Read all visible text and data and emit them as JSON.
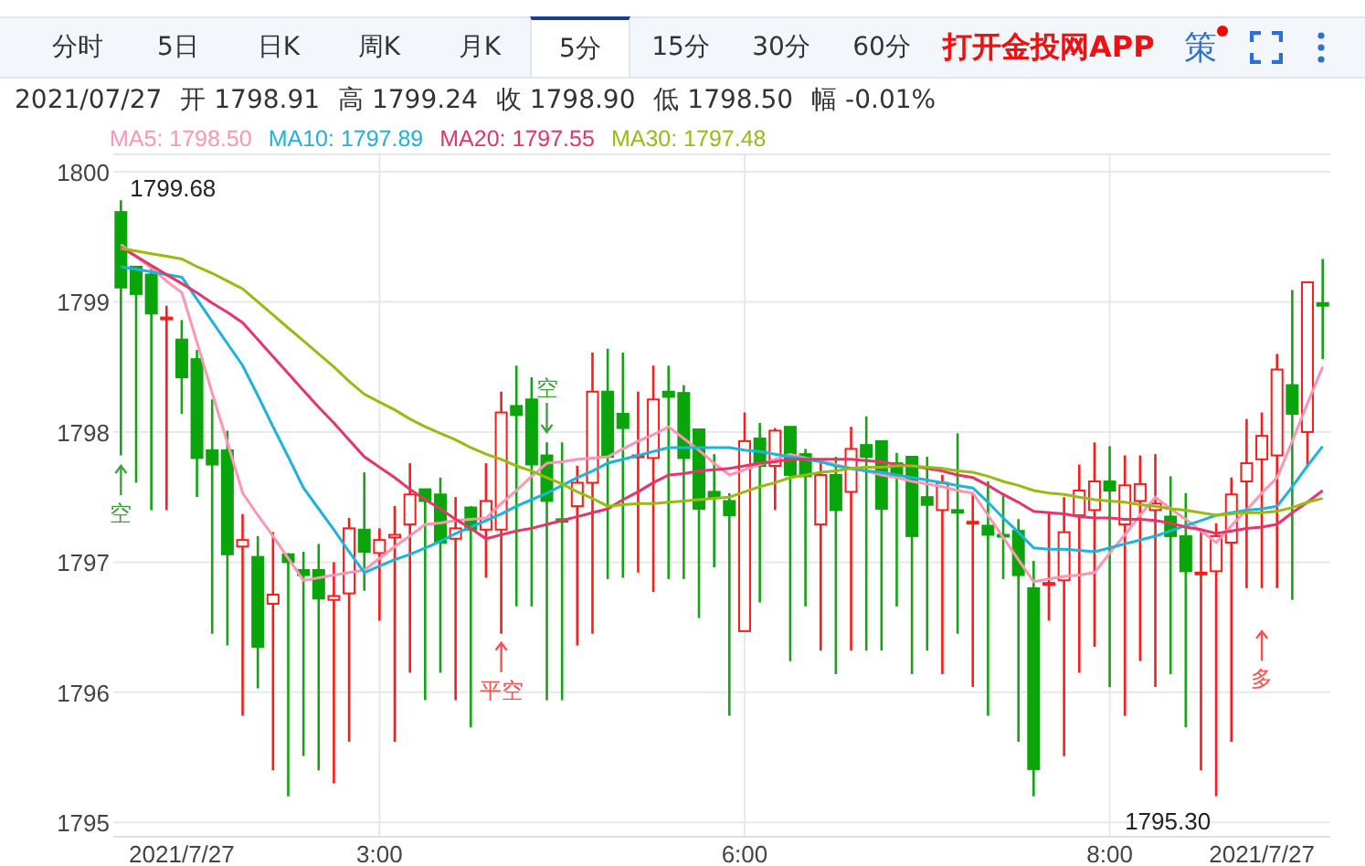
{
  "tabs": [
    {
      "label": "分时",
      "selected": false
    },
    {
      "label": "5日",
      "selected": false
    },
    {
      "label": "日K",
      "selected": false
    },
    {
      "label": "周K",
      "selected": false
    },
    {
      "label": "月K",
      "selected": false
    },
    {
      "label": "5分",
      "selected": true
    },
    {
      "label": "15分",
      "selected": false
    },
    {
      "label": "30分",
      "selected": false
    },
    {
      "label": "60分",
      "selected": false
    }
  ],
  "promo": "打开金投网APP",
  "strategy": {
    "text": "策",
    "dot": true
  },
  "info": [
    "2021/07/27",
    "开 1798.91",
    "高 1799.24",
    "收 1798.90",
    "低 1798.50",
    "幅 -0.01%"
  ],
  "legend": [
    {
      "value": ": 1798.50"
    },
    {
      "value": ": 1797.89"
    },
    {
      "value": ": 1797.55"
    },
    {
      "value": ": 1797.48"
    }
  ],
  "chart": {
    "chart_data": {
      "type": "candlestick",
      "ylim": [
        1794.89,
        1800.14
      ],
      "yticks": [
        1795,
        1796,
        1797,
        1798,
        1799,
        1800
      ],
      "grid": true,
      "categories": [
        null,
        null,
        null,
        null,
        "2021/7/27",
        null,
        null,
        null,
        null,
        null,
        null,
        null,
        null,
        null,
        null,
        null,
        null,
        "3:00",
        null,
        null,
        null,
        null,
        null,
        null,
        null,
        null,
        null,
        null,
        null,
        null,
        null,
        null,
        null,
        null,
        null,
        null,
        null,
        null,
        null,
        null,
        null,
        "6:00",
        null,
        null,
        null,
        null,
        null,
        null,
        null,
        null,
        null,
        null,
        null,
        null,
        null,
        null,
        null,
        null,
        null,
        null,
        null,
        null,
        null,
        null,
        null,
        "8:00",
        null,
        null,
        null,
        null,
        null,
        null,
        null,
        null,
        null,
        "2021/7/27",
        null,
        null,
        null,
        null
      ],
      "ohlc": [
        [
          1799.69,
          1799.78,
          1797.82,
          1799.11
        ],
        [
          1799.27,
          1799.27,
          1797.61,
          1799.06
        ],
        [
          1799.21,
          1799.28,
          1797.4,
          1798.91
        ],
        [
          1798.87,
          1798.97,
          1797.4,
          1798.88
        ],
        [
          1798.71,
          1798.86,
          1798.14,
          1798.42
        ],
        [
          1798.56,
          1798.63,
          1797.5,
          1797.8
        ],
        [
          1797.86,
          1798.25,
          1796.45,
          1797.75
        ],
        [
          1797.86,
          1798.01,
          1796.36,
          1797.06
        ],
        [
          1797.12,
          1797.37,
          1795.82,
          1797.17
        ],
        [
          1797.04,
          1797.2,
          1796.03,
          1796.35
        ],
        [
          1796.68,
          1797.23,
          1795.4,
          1796.75
        ],
        [
          1797.06,
          1797.07,
          1795.2,
          1797.0
        ],
        [
          1796.94,
          1797.08,
          1795.51,
          1796.9
        ],
        [
          1796.94,
          1797.14,
          1795.4,
          1796.72
        ],
        [
          1796.71,
          1797.0,
          1795.3,
          1796.74
        ],
        [
          1796.76,
          1797.34,
          1795.62,
          1797.26
        ],
        [
          1797.25,
          1797.69,
          1796.78,
          1797.08
        ],
        [
          1797.07,
          1797.26,
          1796.55,
          1797.17
        ],
        [
          1797.19,
          1797.43,
          1795.62,
          1797.21
        ],
        [
          1797.29,
          1797.76,
          1796.15,
          1797.52
        ],
        [
          1797.56,
          1797.56,
          1795.94,
          1797.47
        ],
        [
          1797.52,
          1797.65,
          1796.15,
          1797.15
        ],
        [
          1797.18,
          1797.5,
          1795.94,
          1797.26
        ],
        [
          1797.42,
          1797.43,
          1795.73,
          1797.25
        ],
        [
          1797.25,
          1797.76,
          1796.88,
          1797.47
        ],
        [
          1797.25,
          1798.31,
          1796.45,
          1798.15
        ],
        [
          1798.2,
          1798.51,
          1796.66,
          1798.13
        ],
        [
          1798.25,
          1798.42,
          1796.66,
          1797.75
        ],
        [
          1797.82,
          1797.92,
          1795.94,
          1797.47
        ],
        [
          1797.33,
          1797.92,
          1795.94,
          1797.31
        ],
        [
          1797.43,
          1797.74,
          1796.36,
          1797.61
        ],
        [
          1797.61,
          1798.61,
          1796.45,
          1798.31
        ],
        [
          1798.31,
          1798.64,
          1796.87,
          1797.81
        ],
        [
          1798.14,
          1798.61,
          1796.88,
          1798.03
        ],
        [
          1797.81,
          1798.31,
          1796.92,
          1797.82
        ],
        [
          1797.8,
          1798.51,
          1796.77,
          1798.25
        ],
        [
          1798.31,
          1798.51,
          1796.87,
          1798.27
        ],
        [
          1798.3,
          1798.36,
          1796.87,
          1797.8
        ],
        [
          1798.02,
          1798.02,
          1796.57,
          1797.41
        ],
        [
          1797.54,
          1797.83,
          1796.96,
          1797.5
        ],
        [
          1797.47,
          1797.53,
          1795.82,
          1797.36
        ],
        [
          1796.47,
          1798.15,
          1796.47,
          1797.93
        ],
        [
          1797.95,
          1798.07,
          1796.69,
          1797.74
        ],
        [
          1797.74,
          1798.03,
          1797.4,
          1798.01
        ],
        [
          1798.04,
          1798.04,
          1796.24,
          1797.67
        ],
        [
          1797.83,
          1797.87,
          1796.66,
          1797.66
        ],
        [
          1797.29,
          1797.76,
          1796.32,
          1797.67
        ],
        [
          1797.67,
          1797.81,
          1796.14,
          1797.4
        ],
        [
          1797.54,
          1798.04,
          1796.32,
          1797.87
        ],
        [
          1797.9,
          1798.12,
          1796.32,
          1797.81
        ],
        [
          1797.93,
          1797.93,
          1796.32,
          1797.41
        ],
        [
          1797.76,
          1797.84,
          1796.66,
          1797.67
        ],
        [
          1797.81,
          1797.81,
          1796.14,
          1797.2
        ],
        [
          1797.5,
          1797.81,
          1796.32,
          1797.44
        ],
        [
          1797.4,
          1797.67,
          1796.14,
          1797.61
        ],
        [
          1797.4,
          1797.99,
          1796.45,
          1797.38
        ],
        [
          1797.3,
          1797.53,
          1796.04,
          1797.31
        ],
        [
          1797.28,
          1797.62,
          1795.82,
          1797.21
        ],
        [
          1797.21,
          1797.53,
          1796.87,
          1797.2
        ],
        [
          1797.24,
          1797.33,
          1795.62,
          1796.9
        ],
        [
          1796.8,
          1797.01,
          1795.2,
          1795.41
        ],
        [
          1796.83,
          1797.39,
          1796.55,
          1796.84
        ],
        [
          1796.86,
          1797.5,
          1795.51,
          1797.23
        ],
        [
          1797.36,
          1797.75,
          1796.15,
          1797.55
        ],
        [
          1797.4,
          1797.92,
          1796.35,
          1797.62
        ],
        [
          1797.62,
          1797.89,
          1796.04,
          1797.55
        ],
        [
          1797.29,
          1797.82,
          1795.82,
          1797.59
        ],
        [
          1797.47,
          1797.82,
          1796.24,
          1797.6
        ],
        [
          1797.4,
          1797.83,
          1796.04,
          1797.45
        ],
        [
          1797.35,
          1797.66,
          1796.14,
          1797.2
        ],
        [
          1797.2,
          1797.53,
          1795.73,
          1796.93
        ],
        [
          1796.91,
          1797.25,
          1795.4,
          1796.92
        ],
        [
          1796.93,
          1797.3,
          1795.2,
          1797.2
        ],
        [
          1797.15,
          1797.65,
          1795.62,
          1797.52
        ],
        [
          1797.62,
          1798.1,
          1796.8,
          1797.76
        ],
        [
          1797.79,
          1798.15,
          1796.8,
          1797.97
        ],
        [
          1797.82,
          1798.6,
          1796.8,
          1798.48
        ],
        [
          1798.36,
          1799.09,
          1796.71,
          1798.14
        ],
        [
          1798.0,
          1799.15,
          1797.74,
          1799.15
        ],
        [
          1798.99,
          1799.33,
          1798.56,
          1798.97
        ]
      ],
      "series": [
        {
          "name": "MA5",
          "type": "line",
          "color": "#ff94b4",
          "values": [
            1799.44,
            1799.35,
            1799.26,
            1799.16,
            1799.07,
            1798.69,
            1798.3,
            1797.92,
            1797.53,
            1797.36,
            1797.2,
            1797.03,
            1796.86,
            1796.88,
            1796.9,
            1796.92,
            1796.94,
            1797.03,
            1797.12,
            1797.2,
            1797.29,
            1797.3,
            1797.32,
            1797.33,
            1797.34,
            1797.45,
            1797.55,
            1797.66,
            1797.76,
            1797.77,
            1797.79,
            1797.8,
            1797.81,
            1797.87,
            1797.93,
            1797.98,
            1798.04,
            1797.95,
            1797.86,
            1797.76,
            1797.67,
            1797.71,
            1797.75,
            1797.79,
            1797.83,
            1797.8,
            1797.78,
            1797.75,
            1797.72,
            1797.7,
            1797.67,
            1797.65,
            1797.62,
            1797.6,
            1797.58,
            1797.55,
            1797.53,
            1797.36,
            1797.19,
            1797.02,
            1796.85,
            1796.87,
            1796.89,
            1796.9,
            1796.92,
            1797.07,
            1797.21,
            1797.36,
            1797.5,
            1797.41,
            1797.33,
            1797.24,
            1797.15,
            1797.28,
            1797.4,
            1797.53,
            1797.65,
            1797.93,
            1798.22,
            1798.5
          ]
        },
        {
          "name": "MA10",
          "type": "line",
          "color": "#1ab4dc",
          "values": [
            1799.27,
            1799.25,
            1799.23,
            1799.21,
            1799.19,
            1799.02,
            1798.85,
            1798.68,
            1798.51,
            1798.28,
            1798.04,
            1797.81,
            1797.57,
            1797.41,
            1797.25,
            1797.08,
            1796.92,
            1796.97,
            1797.02,
            1797.06,
            1797.11,
            1797.16,
            1797.22,
            1797.27,
            1797.32,
            1797.37,
            1797.43,
            1797.48,
            1797.53,
            1797.59,
            1797.65,
            1797.7,
            1797.76,
            1797.79,
            1797.82,
            1797.85,
            1797.88,
            1797.88,
            1797.88,
            1797.88,
            1797.88,
            1797.86,
            1797.85,
            1797.83,
            1797.81,
            1797.79,
            1797.77,
            1797.74,
            1797.72,
            1797.7,
            1797.69,
            1797.67,
            1797.65,
            1797.63,
            1797.61,
            1797.59,
            1797.57,
            1797.46,
            1797.34,
            1797.23,
            1797.11,
            1797.1,
            1797.1,
            1797.09,
            1797.08,
            1797.11,
            1797.14,
            1797.17,
            1797.2,
            1797.24,
            1797.28,
            1797.32,
            1797.36,
            1797.38,
            1797.4,
            1797.41,
            1797.43,
            1797.58,
            1797.74,
            1797.89
          ]
        },
        {
          "name": "MA20",
          "type": "line",
          "color": "#e8336b",
          "values": [
            1799.42,
            1799.35,
            1799.28,
            1799.21,
            1799.14,
            1799.07,
            1798.99,
            1798.92,
            1798.84,
            1798.71,
            1798.58,
            1798.45,
            1798.32,
            1798.19,
            1798.07,
            1797.94,
            1797.81,
            1797.73,
            1797.65,
            1797.56,
            1797.48,
            1797.41,
            1797.33,
            1797.26,
            1797.18,
            1797.21,
            1797.24,
            1797.26,
            1797.29,
            1797.32,
            1797.35,
            1797.38,
            1797.41,
            1797.48,
            1797.54,
            1797.61,
            1797.67,
            1797.68,
            1797.7,
            1797.71,
            1797.72,
            1797.74,
            1797.76,
            1797.77,
            1797.79,
            1797.79,
            1797.79,
            1797.79,
            1797.79,
            1797.78,
            1797.77,
            1797.75,
            1797.74,
            1797.72,
            1797.7,
            1797.67,
            1797.65,
            1797.59,
            1797.52,
            1797.46,
            1797.39,
            1797.38,
            1797.37,
            1797.35,
            1797.34,
            1797.34,
            1797.33,
            1797.33,
            1797.32,
            1797.3,
            1797.27,
            1797.25,
            1797.22,
            1797.24,
            1797.26,
            1797.27,
            1797.29,
            1797.38,
            1797.46,
            1797.55
          ]
        },
        {
          "name": "MA30",
          "type": "line",
          "color": "#99bb11",
          "values": [
            1799.41,
            1799.39,
            1799.37,
            1799.35,
            1799.33,
            1799.27,
            1799.22,
            1799.16,
            1799.1,
            1799.0,
            1798.9,
            1798.8,
            1798.7,
            1798.6,
            1798.5,
            1798.39,
            1798.29,
            1798.23,
            1798.17,
            1798.1,
            1798.04,
            1797.99,
            1797.94,
            1797.88,
            1797.83,
            1797.79,
            1797.74,
            1797.7,
            1797.65,
            1797.6,
            1797.54,
            1797.49,
            1797.43,
            1797.44,
            1797.45,
            1797.45,
            1797.46,
            1797.47,
            1797.48,
            1797.49,
            1797.5,
            1797.54,
            1797.58,
            1797.61,
            1797.65,
            1797.67,
            1797.69,
            1797.7,
            1797.72,
            1797.73,
            1797.73,
            1797.74,
            1797.74,
            1797.73,
            1797.72,
            1797.7,
            1797.69,
            1797.66,
            1797.62,
            1797.59,
            1797.55,
            1797.53,
            1797.52,
            1797.5,
            1797.48,
            1797.47,
            1797.46,
            1797.44,
            1797.43,
            1797.41,
            1797.4,
            1797.38,
            1797.36,
            1797.37,
            1797.38,
            1797.38,
            1797.39,
            1797.42,
            1797.46,
            1797.49
          ]
        }
      ]
    },
    "markers": [
      {
        "kind": "high",
        "text": "1799.68"
      },
      {
        "kind": "low",
        "text": "1795.30"
      },
      {
        "kind": "up",
        "text": "空",
        "color": "#3aa63a"
      },
      {
        "kind": "down",
        "text": "空",
        "color": "#3aa63a"
      },
      {
        "kind": "up",
        "text": "平空",
        "color": "#ff4d4d"
      },
      {
        "kind": "up",
        "text": "多",
        "color": "#ff4d4d"
      }
    ]
  }
}
